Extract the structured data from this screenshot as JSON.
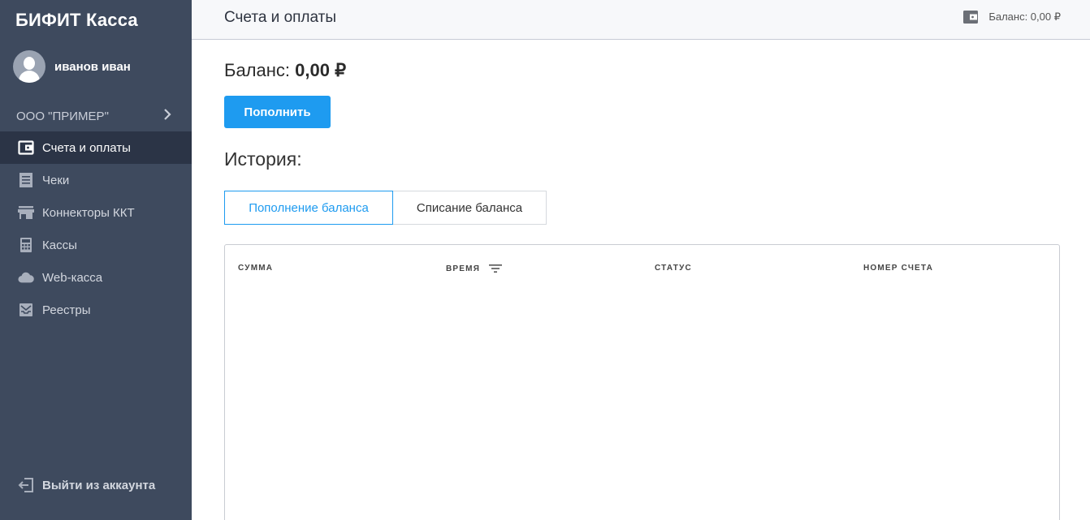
{
  "sidebar": {
    "brand": "БИФИТ Касса",
    "user_name": "иванов иван",
    "org_name": "ООО \"ПРИМЕР\"",
    "items": [
      {
        "label": "Счета и оплаты",
        "icon": "wallet-icon",
        "active": true
      },
      {
        "label": "Чеки",
        "icon": "receipt-icon",
        "active": false
      },
      {
        "label": "Коннекторы ККТ",
        "icon": "store-icon",
        "active": false
      },
      {
        "label": "Кассы",
        "icon": "calculator-icon",
        "active": false
      },
      {
        "label": "Web-касса",
        "icon": "cloud-icon",
        "active": false
      },
      {
        "label": "Реестры",
        "icon": "inbox-icon",
        "active": false
      }
    ],
    "logout_label": "Выйти из аккаунта"
  },
  "header": {
    "title": "Счета и оплаты",
    "balance_label": "Баланс: 0,00 ₽"
  },
  "main": {
    "balance_prefix": "Баланс:",
    "balance_value": "0,00 ₽",
    "topup_button": "Пополнить",
    "history_title": "История:",
    "tabs": [
      {
        "label": "Пополнение баланса",
        "active": true
      },
      {
        "label": "Списание баланса",
        "active": false
      }
    ],
    "table": {
      "columns": [
        "СУММА",
        "ВРЕМЯ",
        "СТАТУС",
        "НОМЕР СЧЕТА"
      ],
      "rows": []
    }
  },
  "colors": {
    "sidebar_bg": "#3e4a5e",
    "sidebar_active_bg": "#2b3446",
    "accent": "#1e9bf0"
  }
}
